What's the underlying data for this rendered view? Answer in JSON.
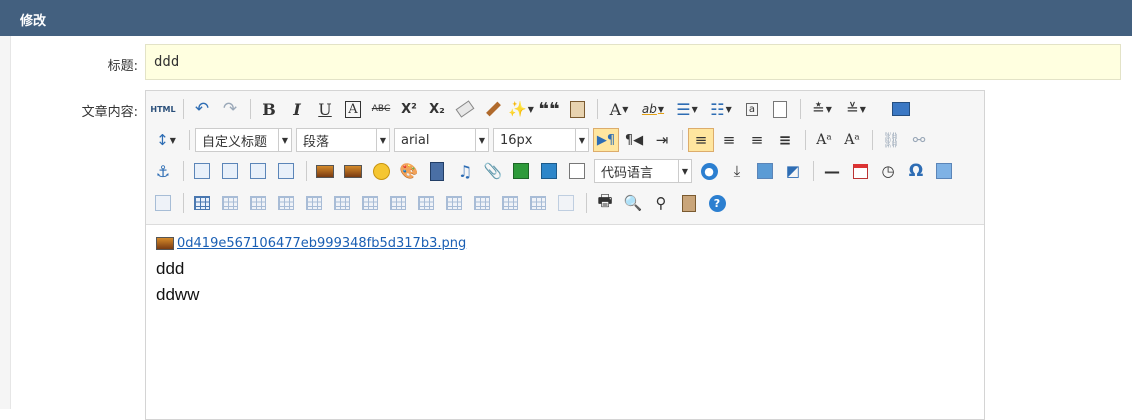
{
  "header": {
    "title": "修改"
  },
  "form": {
    "title_label": "标题:",
    "title_value": "ddd",
    "content_label": "文章内容:"
  },
  "toolbar": {
    "row1": [
      "html",
      "undo",
      "redo",
      "bold",
      "italic",
      "underline",
      "font-border",
      "strikethrough",
      "superscript",
      "subscript",
      "eraser",
      "format-brush",
      "auto-typeset",
      "blockquote",
      "paste-plain",
      "font-color",
      "background-color",
      "ordered-list",
      "unordered-list",
      "select-all",
      "clear-document",
      "row-spacing-top",
      "row-spacing-bottom",
      "preview"
    ],
    "custom_title": "自定义标题",
    "paragraph": "段落",
    "font_family": "arial",
    "font_size": "16px",
    "code_language": "代码语言",
    "labels": {
      "html": "HTML",
      "bold": "B",
      "italic": "I",
      "underline": "U",
      "font_border": "A",
      "strike": "ABC",
      "superscript": "X²",
      "subscript": "X₂",
      "quote": "❝❝",
      "font_color": "A",
      "bg_color": "ab",
      "omega": "Ω",
      "help": "?",
      "dash": "—"
    }
  },
  "content": {
    "file_name": "0d419e567106477eb999348fb5d317b3.png",
    "paragraphs": [
      "ddd",
      "ddww"
    ]
  },
  "colors": {
    "header_bg": "#43607f",
    "input_bg": "#ffffe0",
    "link": "#1a5fb4",
    "active_btn": "#ffe69f"
  }
}
